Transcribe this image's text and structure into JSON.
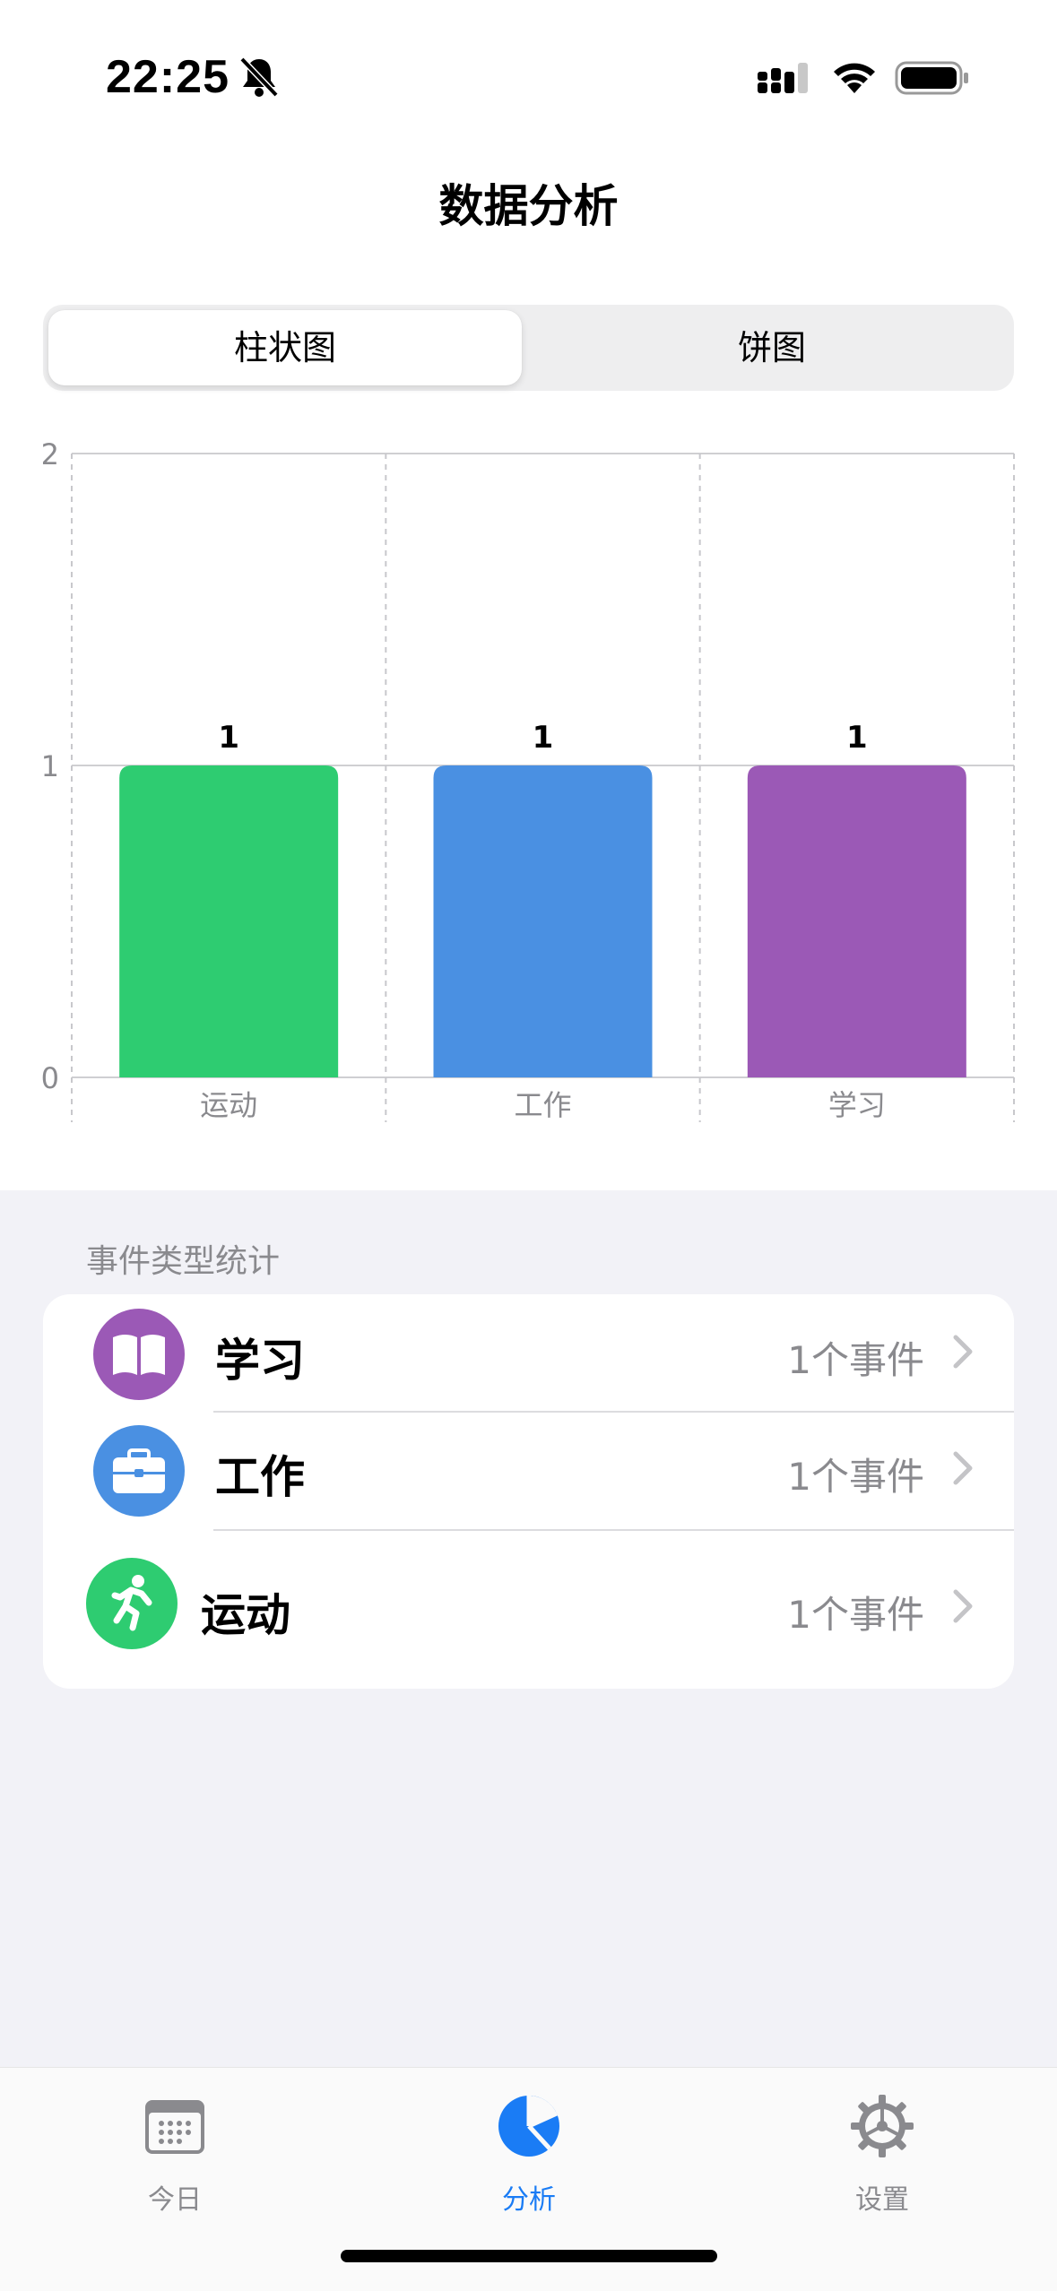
{
  "status": {
    "time": "22:25"
  },
  "header": {
    "title": "数据分析"
  },
  "segments": {
    "left": "柱状图",
    "right": "饼图",
    "selected": "柱状图"
  },
  "chart_data": {
    "type": "bar",
    "categories": [
      "运动",
      "工作",
      "学习"
    ],
    "values": [
      1,
      1,
      1
    ],
    "data_labels": [
      "1",
      "1",
      "1"
    ],
    "colors": [
      "#2ecc71",
      "#4a90e2",
      "#9b59b6"
    ],
    "ylim": [
      0,
      2
    ],
    "yticks": [
      "0",
      "1",
      "2"
    ],
    "grid": true
  },
  "list": {
    "header": "事件类型统计",
    "items": [
      {
        "label": "学习",
        "count": "1个事件",
        "icon": "book-icon",
        "color": "#9b59b6"
      },
      {
        "label": "工作",
        "count": "1个事件",
        "icon": "briefcase-icon",
        "color": "#4a90e2"
      },
      {
        "label": "运动",
        "count": "1个事件",
        "icon": "running-icon",
        "color": "#2ecc71"
      }
    ]
  },
  "tabs": [
    {
      "label": "今日",
      "icon": "calendar-icon",
      "active": false
    },
    {
      "label": "分析",
      "icon": "pie-chart-icon",
      "active": true
    },
    {
      "label": "设置",
      "icon": "gear-icon",
      "active": false
    }
  ]
}
